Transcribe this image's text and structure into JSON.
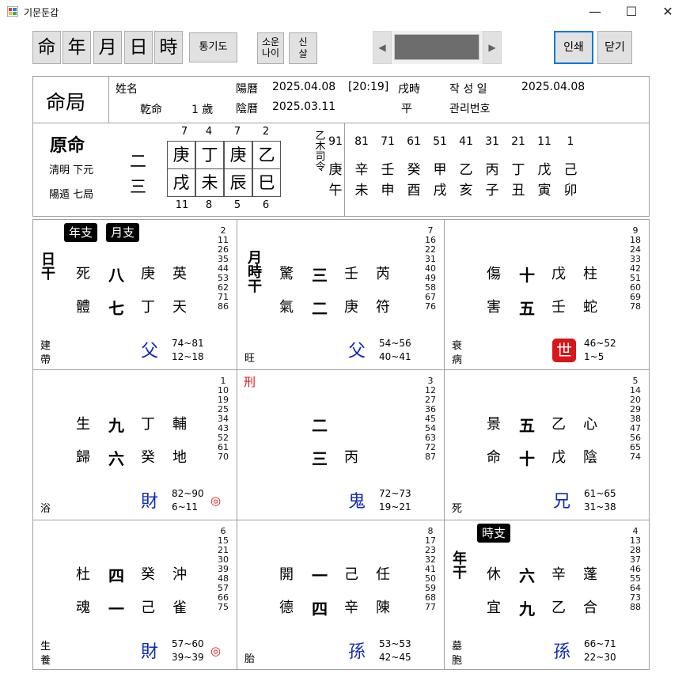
{
  "window": {
    "title": "기문둔갑",
    "min": "—",
    "max": "☐",
    "close": "✕"
  },
  "toolbar": {
    "big_buttons": [
      "命",
      "年",
      "月",
      "日",
      "時"
    ],
    "tonggido": "통기도",
    "sowoon_l1": "소운",
    "sowoon_l2": "나이",
    "shinsal_l1": "신",
    "shinsal_l2": "살",
    "print": "인쇄",
    "close": "닫기"
  },
  "header": {
    "title": "命局",
    "name_label": "姓名",
    "gender": "乾命",
    "age": "1 歲",
    "solar_label": "陽曆",
    "solar_date": "2025.04.08",
    "time": "[20:19]",
    "hour_pillar": "戌時",
    "lunar_label": "陰曆",
    "lunar_date": "2025.03.11",
    "lunar_extra": "平",
    "created_label": "작 성 일",
    "created_date": "2025.04.08",
    "manage_label": "관리번호"
  },
  "wonmyeong": {
    "title": "原命",
    "line1": "淸明 下元",
    "line2": "陽遁 七局",
    "side_top": "二",
    "side_bottom": "三",
    "top_nums": [
      "7",
      "4",
      "7",
      "2"
    ],
    "stems": [
      "庚",
      "丁",
      "庚",
      "乙"
    ],
    "branches": [
      "戌",
      "未",
      "辰",
      "巳"
    ],
    "bottom_nums": [
      "11",
      "8",
      "5",
      "6"
    ],
    "vertical": [
      "乙",
      "木",
      "司",
      "令"
    ],
    "daeun_ages": [
      "91",
      "81",
      "71",
      "61",
      "51",
      "41",
      "31",
      "21",
      "11",
      "1"
    ],
    "daeun_stems": [
      "庚",
      "辛",
      "壬",
      "癸",
      "甲",
      "乙",
      "丙",
      "丁",
      "戊",
      "己"
    ],
    "daeun_branches": [
      "午",
      "未",
      "申",
      "酉",
      "戌",
      "亥",
      "子",
      "丑",
      "寅",
      "卯"
    ]
  },
  "palaces": [
    {
      "badges": [
        "年支",
        "月支"
      ],
      "side": [
        "日",
        "干"
      ],
      "row1": [
        "死",
        "八",
        "庚",
        "英"
      ],
      "row2": [
        "體",
        "七",
        "丁",
        "天"
      ],
      "nums": [
        "2",
        "11",
        "26",
        "35",
        "44",
        "53",
        "62",
        "71",
        "86"
      ],
      "bl": [
        "建",
        "帶"
      ],
      "kin": "父",
      "range1": "74~81",
      "range2": "12~18"
    },
    {
      "side": [
        "月",
        "時",
        "干"
      ],
      "row1": [
        "驚",
        "三",
        "壬",
        "芮"
      ],
      "row2": [
        "氣",
        "二",
        "庚",
        "符"
      ],
      "nums": [
        "7",
        "16",
        "22",
        "31",
        "40",
        "49",
        "58",
        "67",
        "76"
      ],
      "bl": [
        "旺"
      ],
      "kin": "父",
      "range1": "54~56",
      "range2": "40~41"
    },
    {
      "row1": [
        "傷",
        "十",
        "戊",
        "柱"
      ],
      "row2": [
        "害",
        "五",
        "壬",
        "蛇"
      ],
      "nums": [
        "9",
        "18",
        "24",
        "33",
        "42",
        "51",
        "60",
        "69",
        "78"
      ],
      "bl": [
        "衰",
        "病"
      ],
      "se": "世",
      "range1": "46~52",
      "range2": "1~5"
    },
    {
      "row1": [
        "生",
        "九",
        "丁",
        "輔"
      ],
      "row2": [
        "歸",
        "六",
        "癸",
        "地"
      ],
      "nums": [
        "1",
        "10",
        "19",
        "25",
        "34",
        "43",
        "52",
        "61",
        "70"
      ],
      "bl": [
        "浴"
      ],
      "kin": "財",
      "range1": "82~90",
      "range2": "6~11",
      "mark": "◎"
    },
    {
      "top_red": "刑",
      "row1": [
        "",
        "二",
        "",
        ""
      ],
      "row2": [
        "",
        "三",
        "丙",
        ""
      ],
      "nums": [
        "3",
        "12",
        "27",
        "36",
        "45",
        "54",
        "63",
        "72",
        "87"
      ],
      "kin": "鬼",
      "range1": "72~73",
      "range2": "19~21"
    },
    {
      "row1": [
        "景",
        "五",
        "乙",
        "心"
      ],
      "row2": [
        "命",
        "十",
        "戊",
        "陰"
      ],
      "nums": [
        "5",
        "14",
        "20",
        "29",
        "38",
        "47",
        "56",
        "65",
        "74"
      ],
      "bl": [
        "死"
      ],
      "kin": "兄",
      "range1": "61~65",
      "range2": "31~38"
    },
    {
      "row1": [
        "杜",
        "四",
        "癸",
        "沖"
      ],
      "row2": [
        "魂",
        "一",
        "己",
        "雀"
      ],
      "nums": [
        "6",
        "15",
        "21",
        "30",
        "39",
        "48",
        "57",
        "66",
        "75"
      ],
      "bl": [
        "生",
        "養"
      ],
      "kin": "財",
      "range1": "57~60",
      "range2": "39~39",
      "mark": "◎"
    },
    {
      "row1": [
        "開",
        "一",
        "己",
        "任"
      ],
      "row2": [
        "德",
        "四",
        "辛",
        "陳"
      ],
      "nums": [
        "8",
        "17",
        "23",
        "32",
        "41",
        "50",
        "59",
        "68",
        "77"
      ],
      "bl": [
        "胎"
      ],
      "kin": "孫",
      "range1": "53~53",
      "range2": "42~45"
    },
    {
      "badges": [
        "時支"
      ],
      "side": [
        "年",
        "干"
      ],
      "row1": [
        "休",
        "六",
        "辛",
        "蓬"
      ],
      "row2": [
        "宜",
        "九",
        "乙",
        "合"
      ],
      "nums": [
        "4",
        "13",
        "28",
        "37",
        "46",
        "55",
        "64",
        "73",
        "88"
      ],
      "bl": [
        "墓",
        "胞"
      ],
      "kin": "孫",
      "range1": "66~71",
      "range2": "22~30"
    }
  ],
  "colors": {
    "kin_blue": "#0d2ab8",
    "se_red": "#d9161b",
    "mark_red": "#d9161b",
    "badge_bg": "#000000",
    "print_border": "#0078d7"
  }
}
